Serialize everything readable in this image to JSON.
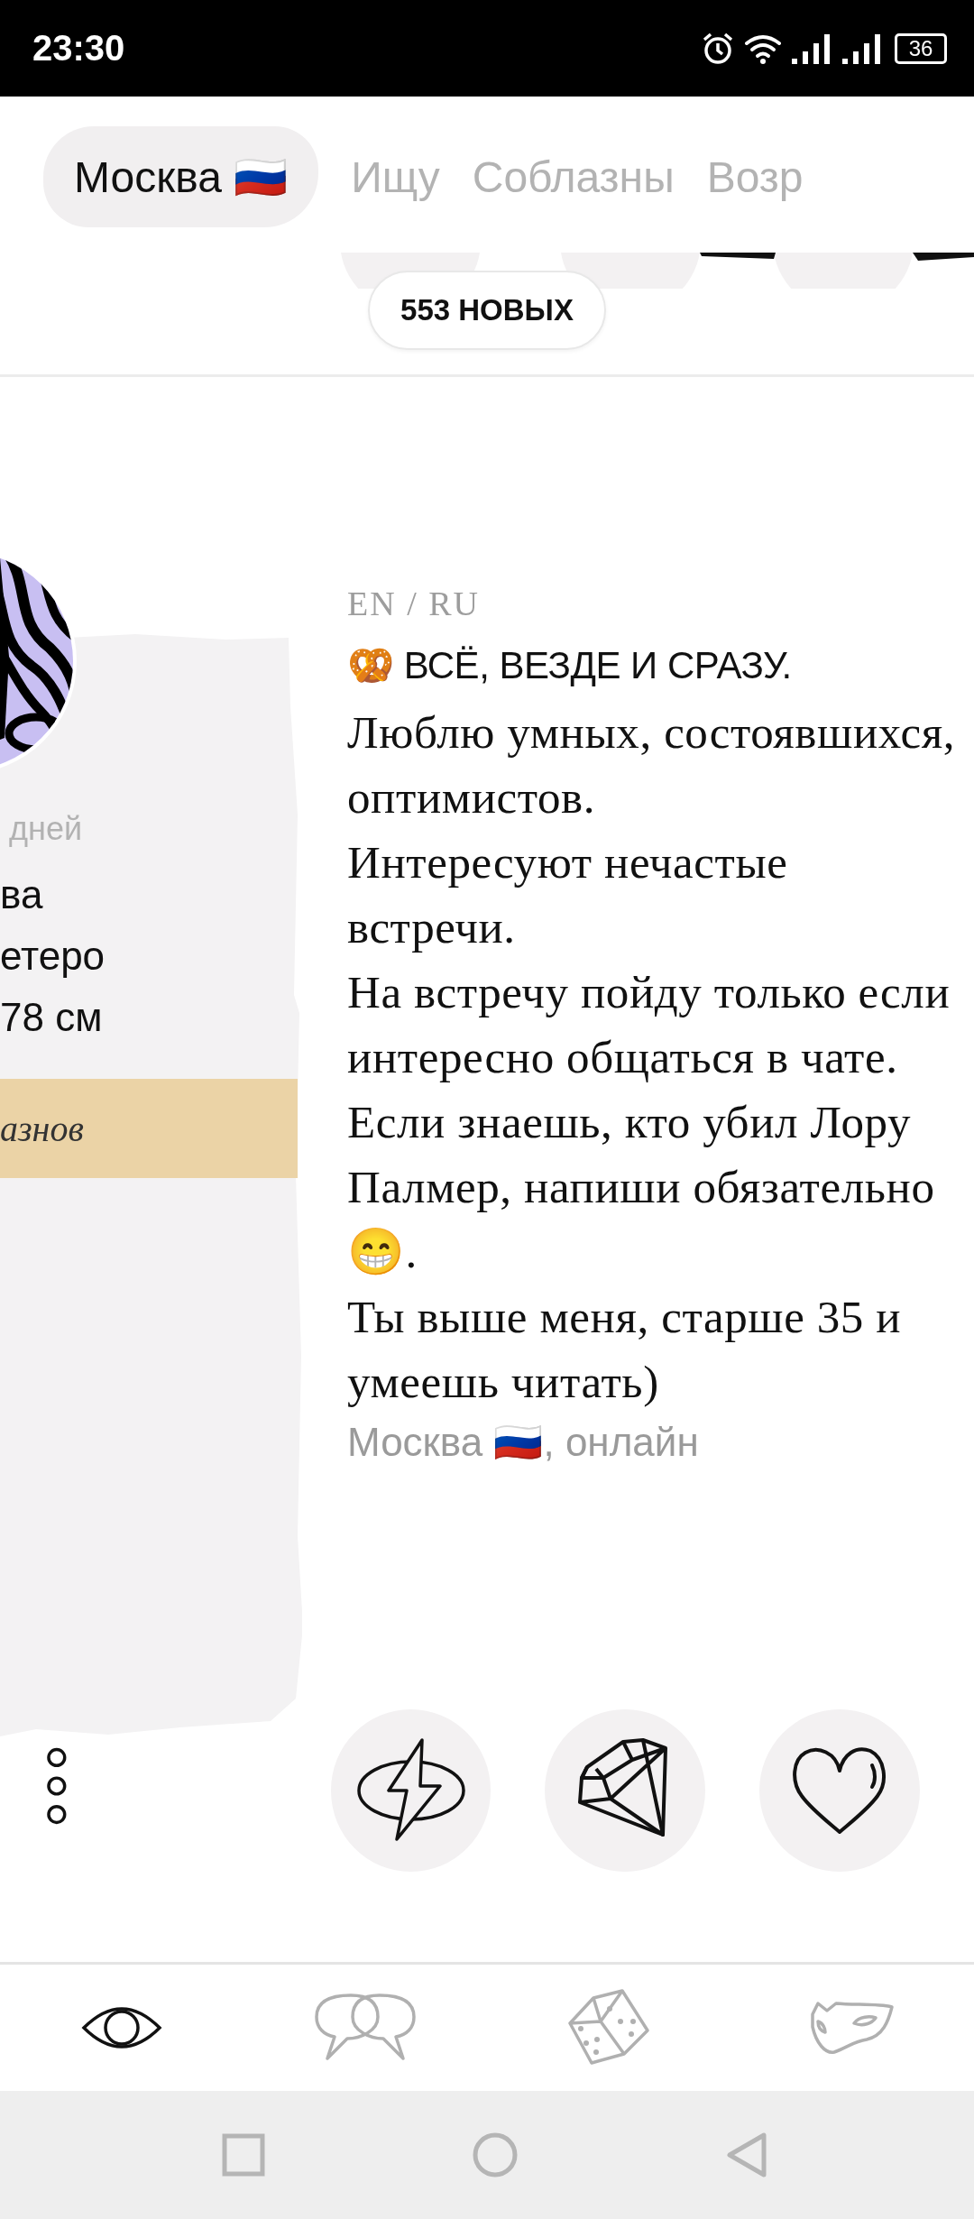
{
  "status_bar": {
    "time": "23:30",
    "battery": "36"
  },
  "tabs": [
    {
      "label": "Москва 🇷🇺",
      "selected": true
    },
    {
      "label": "Ищу",
      "selected": false
    },
    {
      "label": "Соблазны",
      "selected": false
    },
    {
      "label": "Возр",
      "selected": false
    }
  ],
  "new_badge": "553 НОВЫХ",
  "side_panel": {
    "joined": "дней",
    "facts": [
      "ва",
      "етеро",
      "78 см"
    ],
    "band": "азнов"
  },
  "profile": {
    "languages": "EN / RU",
    "headline": "🥨 ВСЁ, ВЕЗДЕ И СРАЗУ.",
    "bio": "Люблю умных, состоявшихся, оптимистов.\nИнтересуют нечастые встречи.\nНа встречу пойду только если интересно общаться в чате.\nЕсли знаешь, кто убил Лору Палмер, напиши обязательно 😁.\nТы выше меня, старше 35 и умеешь читать)",
    "location": "Москва 🇷🇺, онлайн"
  },
  "actions": [
    {
      "kind": "boost"
    },
    {
      "kind": "gem"
    },
    {
      "kind": "like"
    }
  ],
  "bottom_nav": [
    {
      "kind": "watch",
      "selected": true
    },
    {
      "kind": "chats",
      "selected": false
    },
    {
      "kind": "dice",
      "selected": false
    },
    {
      "kind": "mask",
      "selected": false
    }
  ]
}
